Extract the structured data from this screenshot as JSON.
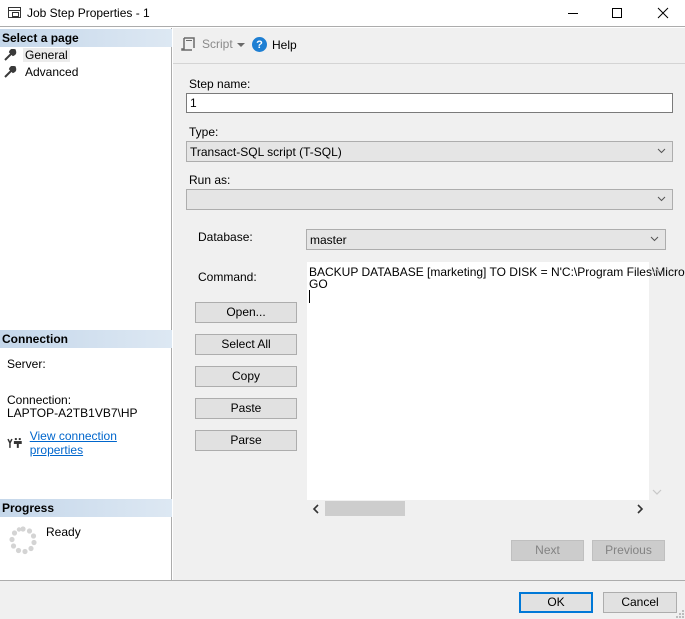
{
  "window": {
    "title": "Job Step Properties - 1",
    "controls": {
      "minimize": "minimize",
      "maximize": "maximize",
      "close": "close"
    }
  },
  "sidebar": {
    "select_page_header": "Select a page",
    "pages": [
      {
        "label": "General",
        "icon": "wrench-icon",
        "selected": true
      },
      {
        "label": "Advanced",
        "icon": "wrench-icon",
        "selected": false
      }
    ],
    "connection": {
      "header": "Connection",
      "server_label": "Server:",
      "server_value": "",
      "connection_label": "Connection:",
      "connection_value": "LAPTOP-A2TB1VB7\\HP",
      "view_link": "View connection properties"
    },
    "progress": {
      "header": "Progress",
      "status": "Ready"
    }
  },
  "toolbar": {
    "script_label": "Script",
    "help_label": "Help"
  },
  "form": {
    "step_name_label": "Step name:",
    "step_name_value": "1",
    "type_label": "Type:",
    "type_value": "Transact-SQL script (T-SQL)",
    "run_as_label": "Run as:",
    "run_as_value": "",
    "database_label": "Database:",
    "database_value": "master",
    "command_label": "Command:",
    "command_lines": [
      "BACKUP DATABASE [marketing] TO  DISK = N'C:\\Program Files\\Micro",
      "GO"
    ],
    "buttons": {
      "open": "Open...",
      "select_all": "Select All",
      "copy": "Copy",
      "paste": "Paste",
      "parse": "Parse"
    }
  },
  "navigation": {
    "next": "Next",
    "previous": "Previous"
  },
  "dialog": {
    "ok": "OK",
    "cancel": "Cancel"
  }
}
